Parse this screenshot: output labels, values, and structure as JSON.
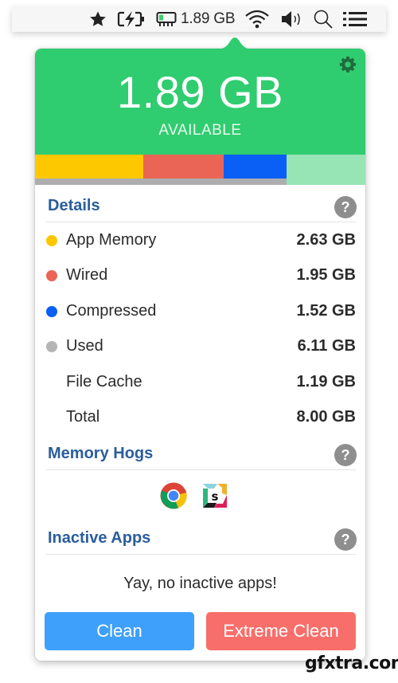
{
  "menubar": {
    "items": [
      {
        "icon": "star-icon"
      },
      {
        "icon": "battery-charging-icon"
      },
      {
        "icon": "memory-chip-icon",
        "label": "1.89 GB"
      },
      {
        "icon": "wifi-icon"
      },
      {
        "icon": "volume-icon"
      },
      {
        "icon": "search-icon"
      },
      {
        "icon": "list-icon"
      }
    ],
    "memory_label": "1.89 GB"
  },
  "header": {
    "available_value": "1.89 GB",
    "available_label": "AVAILABLE",
    "settings_icon": "gear-icon"
  },
  "memory_bar": {
    "total_gb": 8.0,
    "segments": [
      {
        "name": "App Memory",
        "gb": 2.63,
        "color": "#fdc800"
      },
      {
        "name": "Wired",
        "gb": 1.95,
        "color": "#ea6556"
      },
      {
        "name": "Compressed",
        "gb": 1.52,
        "color": "#0a5ff5"
      },
      {
        "name": "Free",
        "gb": 1.89,
        "color": "#97e4b5"
      }
    ],
    "used_gb": 6.11,
    "used_color": "#adadb0"
  },
  "details": {
    "title": "Details",
    "rows": [
      {
        "label": "App Memory",
        "value": "2.63 GB",
        "dot_color": "#fdc800"
      },
      {
        "label": "Wired",
        "value": "1.95 GB",
        "dot_color": "#ea6556"
      },
      {
        "label": "Compressed",
        "value": "1.52 GB",
        "dot_color": "#0a5ff5"
      },
      {
        "label": "Used",
        "value": "6.11 GB",
        "dot_color": "#b5b5b5"
      },
      {
        "label": "File Cache",
        "value": "1.19 GB",
        "dot_color": null
      },
      {
        "label": "Total",
        "value": "8.00 GB",
        "dot_color": null
      }
    ]
  },
  "memory_hogs": {
    "title": "Memory Hogs",
    "apps": [
      {
        "name": "Google Chrome",
        "icon": "chrome-icon"
      },
      {
        "name": "Slack",
        "icon": "slack-icon"
      }
    ]
  },
  "inactive_apps": {
    "title": "Inactive Apps",
    "empty_message": "Yay, no inactive apps!"
  },
  "buttons": {
    "clean_label": "Clean",
    "extreme_clean_label": "Extreme Clean"
  },
  "colors": {
    "header_green": "#30cc70",
    "section_title_blue": "#2a5d9c",
    "clean_button": "#3fa0fb",
    "extreme_clean_button": "#f86e6a",
    "help_gray": "#8e8e8e"
  },
  "watermark": "gfxtra.com"
}
